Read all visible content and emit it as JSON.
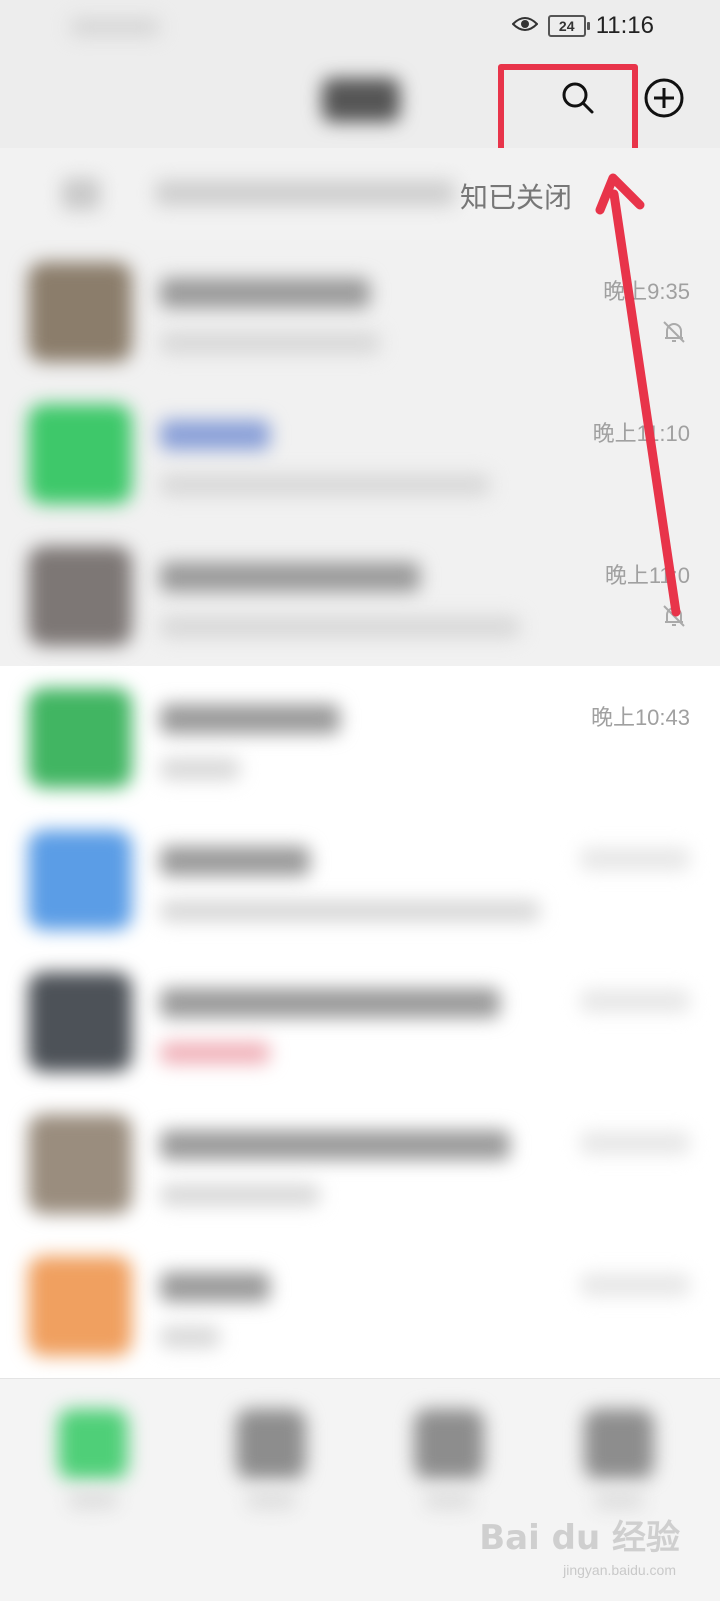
{
  "status_bar": {
    "time": "11:16",
    "battery": "24",
    "icons": [
      "eye-icon",
      "battery-icon"
    ]
  },
  "header": {
    "search_icon": "search-icon",
    "add_icon": "plus-circle-icon"
  },
  "notice": {
    "text": "知已关闭"
  },
  "chats": [
    {
      "time": "晚上9:35",
      "muted": true
    },
    {
      "time": "晚上11:10",
      "muted": false
    },
    {
      "time": "晚上11:0",
      "muted": true
    },
    {
      "time": "晚上10:43",
      "muted": false
    },
    {
      "time": "",
      "muted": false
    },
    {
      "time": "",
      "muted": false
    },
    {
      "time": "",
      "muted": false
    },
    {
      "time": "",
      "muted": false
    }
  ],
  "watermark": {
    "brand": "Bai du 经验",
    "url": "jingyan.baidu.com"
  },
  "colors": {
    "highlight": "#e8344a",
    "wechat_green": "#3ec86a",
    "status_gray": "#ededed"
  }
}
